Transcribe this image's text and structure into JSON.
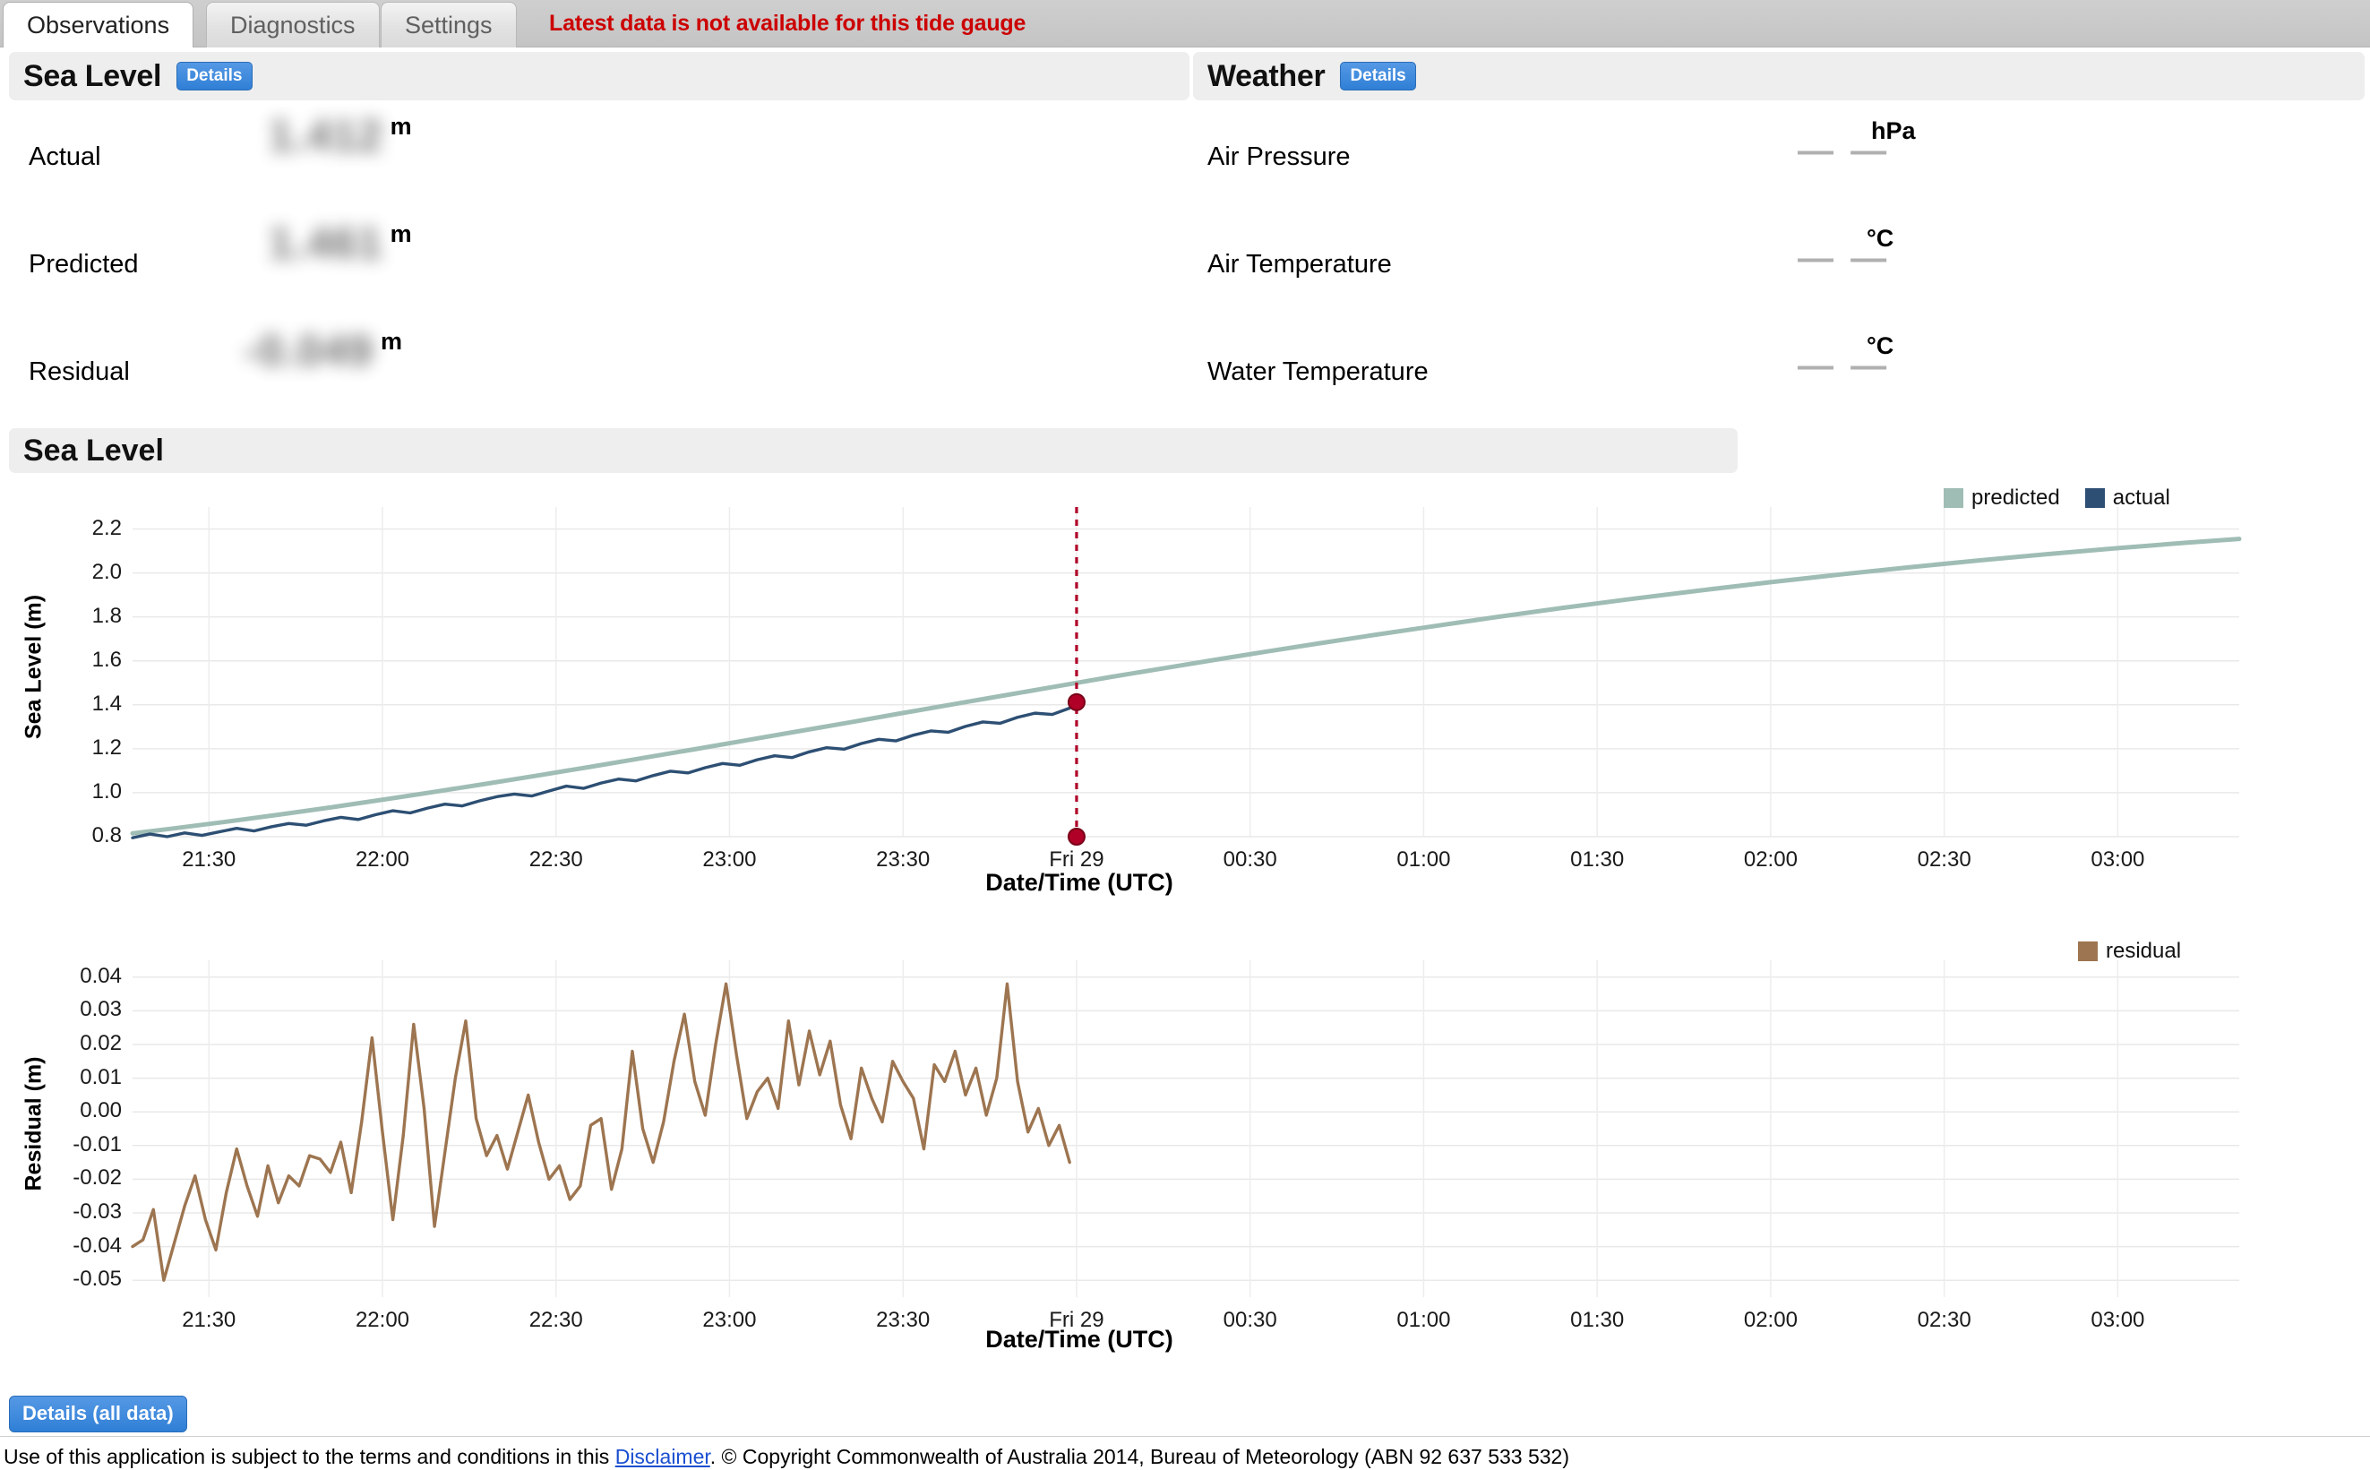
{
  "tabs": [
    {
      "id": "observations",
      "label": "Observations",
      "active": true
    },
    {
      "id": "diagnostics",
      "label": "Diagnostics",
      "active": false
    },
    {
      "id": "settings",
      "label": "Settings",
      "active": false
    }
  ],
  "alert": {
    "message": "Latest data is not available for this tide gauge",
    "color": "#cc0000"
  },
  "sea_level_panel": {
    "title": "Sea Level",
    "details_label": "Details",
    "rows": [
      {
        "label": "Actual",
        "value": "1.412",
        "unit": "m",
        "redacted": true
      },
      {
        "label": "Predicted",
        "value": "1.461",
        "unit": "m",
        "redacted": true
      },
      {
        "label": "Residual",
        "value": "-0.049",
        "unit": "m",
        "redacted": true
      }
    ]
  },
  "weather_panel": {
    "title": "Weather",
    "details_label": "Details",
    "rows": [
      {
        "label": "Air Pressure",
        "value": "— —",
        "unit": "hPa"
      },
      {
        "label": "Air Temperature",
        "value": "— —",
        "unit": "°C"
      },
      {
        "label": "Water Temperature",
        "value": "— —",
        "unit": "°C"
      }
    ]
  },
  "chart_section": {
    "title": "Sea Level"
  },
  "footer": {
    "details_all_label": "Details (all data)",
    "text_before": "Use of this application is subject to the terms and conditions in this ",
    "disclaimer_link": "Disclaimer",
    "text_after": ". © Copyright Commonwealth of Australia 2014, Bureau of Meteorology (ABN 92 637 533 532)"
  },
  "colors": {
    "predicted": "#9fbdb4",
    "actual": "#2d4f73",
    "residual": "#9d7550",
    "marker": "#b00028",
    "accent_blue": "#2f7fd6",
    "panel_bg": "#eeeeee"
  },
  "chart_data": [
    {
      "id": "sea-level-chart",
      "type": "line",
      "title": "Sea Level",
      "xlabel": "Date/Time (UTC)",
      "ylabel": "Sea Level (m)",
      "ylim": [
        0.8,
        2.3
      ],
      "yticks": [
        "0.8",
        "1.0",
        "1.2",
        "1.4",
        "1.6",
        "1.8",
        "2.0",
        "2.2"
      ],
      "ytick_values": [
        0.8,
        1.0,
        1.2,
        1.4,
        1.6,
        1.8,
        2.0,
        2.2
      ],
      "xticks": [
        "21:30",
        "22:00",
        "22:30",
        "23:00",
        "23:30",
        "Fri 29",
        "00:30",
        "01:00",
        "01:30",
        "02:00",
        "02:30",
        "03:00"
      ],
      "xtick_values": [
        21.5,
        22.0,
        22.5,
        23.0,
        23.5,
        24.0,
        24.5,
        25.0,
        25.5,
        26.0,
        26.5,
        27.0
      ],
      "xlim": [
        21.28,
        27.35
      ],
      "grid": true,
      "legend": [
        "predicted",
        "actual"
      ],
      "legend_position": "top-right",
      "marker": {
        "x": 24.0,
        "y_top": 1.412,
        "y_bottom": 0.8,
        "label": "Fri 29",
        "style": "dashed-vline-with-dots"
      },
      "series": [
        {
          "name": "predicted",
          "color": "#9fbdb4",
          "x": [
            21.28,
            21.4,
            21.55,
            21.7,
            21.85,
            22.0,
            22.15,
            22.3,
            22.45,
            22.6,
            22.75,
            22.9,
            23.05,
            23.2,
            23.35,
            23.5,
            23.65,
            23.8,
            23.95,
            24.1,
            24.25,
            24.4,
            24.55,
            24.7,
            24.85,
            25.0,
            25.2,
            25.4,
            25.6,
            25.8,
            26.0,
            26.2,
            26.4,
            26.6,
            26.8,
            27.0,
            27.2,
            27.35
          ],
          "y": [
            0.815,
            0.838,
            0.868,
            0.9,
            0.933,
            0.968,
            1.004,
            1.041,
            1.079,
            1.118,
            1.158,
            1.198,
            1.239,
            1.28,
            1.321,
            1.363,
            1.404,
            1.445,
            1.486,
            1.527,
            1.566,
            1.605,
            1.643,
            1.68,
            1.716,
            1.751,
            1.797,
            1.841,
            1.882,
            1.921,
            1.958,
            1.993,
            2.026,
            2.057,
            2.086,
            2.113,
            2.138,
            2.155
          ]
        },
        {
          "name": "actual",
          "color": "#2d4f73",
          "note": "noisy observed trace, terminates at marker (Fri 29 / 24.0) at 1.412",
          "x": [
            21.28,
            21.33,
            21.38,
            21.43,
            21.48,
            21.53,
            21.58,
            21.63,
            21.68,
            21.73,
            21.78,
            21.83,
            21.88,
            21.93,
            21.98,
            22.03,
            22.08,
            22.13,
            22.18,
            22.23,
            22.28,
            22.33,
            22.38,
            22.43,
            22.48,
            22.53,
            22.58,
            22.63,
            22.68,
            22.73,
            22.78,
            22.83,
            22.88,
            22.93,
            22.98,
            23.03,
            23.08,
            23.13,
            23.18,
            23.23,
            23.28,
            23.33,
            23.38,
            23.43,
            23.48,
            23.53,
            23.58,
            23.63,
            23.68,
            23.73,
            23.78,
            23.83,
            23.88,
            23.93,
            23.98,
            24.0
          ],
          "y": [
            0.795,
            0.812,
            0.8,
            0.817,
            0.806,
            0.822,
            0.838,
            0.826,
            0.845,
            0.86,
            0.852,
            0.872,
            0.888,
            0.878,
            0.9,
            0.918,
            0.908,
            0.93,
            0.948,
            0.94,
            0.963,
            0.982,
            0.994,
            0.985,
            1.008,
            1.03,
            1.02,
            1.044,
            1.062,
            1.054,
            1.078,
            1.098,
            1.09,
            1.114,
            1.133,
            1.125,
            1.15,
            1.168,
            1.16,
            1.186,
            1.205,
            1.198,
            1.224,
            1.243,
            1.236,
            1.262,
            1.281,
            1.275,
            1.302,
            1.322,
            1.316,
            1.343,
            1.362,
            1.356,
            1.385,
            1.412
          ]
        }
      ]
    },
    {
      "id": "residual-chart",
      "type": "line",
      "xlabel": "Date/Time (UTC)",
      "ylabel": "Residual (m)",
      "ylim": [
        -0.055,
        0.045
      ],
      "yticks": [
        "0.04",
        "0.03",
        "0.02",
        "0.01",
        "0.00",
        "-0.01",
        "-0.02",
        "-0.03",
        "-0.04",
        "-0.05"
      ],
      "ytick_values": [
        0.04,
        0.03,
        0.02,
        0.01,
        0.0,
        -0.01,
        -0.02,
        -0.03,
        -0.04,
        -0.05
      ],
      "xticks": [
        "21:30",
        "22:00",
        "22:30",
        "23:00",
        "23:30",
        "Fri 29",
        "00:30",
        "01:00",
        "01:30",
        "02:00",
        "02:30",
        "03:00"
      ],
      "xtick_values": [
        21.5,
        22.0,
        22.5,
        23.0,
        23.5,
        24.0,
        24.5,
        25.0,
        25.5,
        26.0,
        26.5,
        27.0
      ],
      "xlim": [
        21.28,
        27.35
      ],
      "grid": true,
      "legend": [
        "residual"
      ],
      "legend_position": "top-right",
      "series": [
        {
          "name": "residual",
          "color": "#9d7550",
          "note": "high-frequency noise; mean drifts from about -0.03 up to +0.02 then falls to about -0.04",
          "x": [
            21.28,
            21.31,
            21.34,
            21.37,
            21.4,
            21.43,
            21.46,
            21.49,
            21.52,
            21.55,
            21.58,
            21.61,
            21.64,
            21.67,
            21.7,
            21.73,
            21.76,
            21.79,
            21.82,
            21.85,
            21.88,
            21.91,
            21.94,
            21.97,
            22.0,
            22.03,
            22.06,
            22.09,
            22.12,
            22.15,
            22.18,
            22.21,
            22.24,
            22.27,
            22.3,
            22.33,
            22.36,
            22.39,
            22.42,
            22.45,
            22.48,
            22.51,
            22.54,
            22.57,
            22.6,
            22.63,
            22.66,
            22.69,
            22.72,
            22.75,
            22.78,
            22.81,
            22.84,
            22.87,
            22.9,
            22.93,
            22.96,
            22.99,
            23.02,
            23.05,
            23.08,
            23.11,
            23.14,
            23.17,
            23.2,
            23.23,
            23.26,
            23.29,
            23.32,
            23.35,
            23.38,
            23.41,
            23.44,
            23.47,
            23.5,
            23.53,
            23.56,
            23.59,
            23.62,
            23.65,
            23.68,
            23.71,
            23.74,
            23.77,
            23.8,
            23.83,
            23.86,
            23.89,
            23.92,
            23.95,
            23.98,
            24.0
          ],
          "y": [
            -0.04,
            -0.038,
            -0.029,
            -0.05,
            -0.039,
            -0.028,
            -0.019,
            -0.032,
            -0.041,
            -0.024,
            -0.011,
            -0.022,
            -0.031,
            -0.016,
            -0.027,
            -0.019,
            -0.022,
            -0.013,
            -0.014,
            -0.018,
            -0.009,
            -0.024,
            -0.003,
            0.022,
            -0.006,
            -0.032,
            -0.007,
            0.026,
            0.001,
            -0.034,
            -0.012,
            0.01,
            0.027,
            -0.002,
            -0.013,
            -0.007,
            -0.017,
            -0.006,
            0.005,
            -0.009,
            -0.02,
            -0.016,
            -0.026,
            -0.022,
            -0.004,
            -0.002,
            -0.023,
            -0.011,
            0.018,
            -0.005,
            -0.015,
            -0.003,
            0.015,
            0.029,
            0.009,
            -0.001,
            0.02,
            0.038,
            0.017,
            -0.002,
            0.006,
            0.01,
            0.001,
            0.027,
            0.008,
            0.024,
            0.011,
            0.021,
            0.002,
            -0.008,
            0.013,
            0.004,
            -0.003,
            0.015,
            0.009,
            0.004,
            -0.011,
            0.014,
            0.009,
            0.018,
            0.005,
            0.013,
            -0.001,
            0.01,
            0.038,
            0.009,
            -0.006,
            0.001,
            -0.01,
            -0.004,
            -0.015
          ]
        }
      ]
    }
  ]
}
